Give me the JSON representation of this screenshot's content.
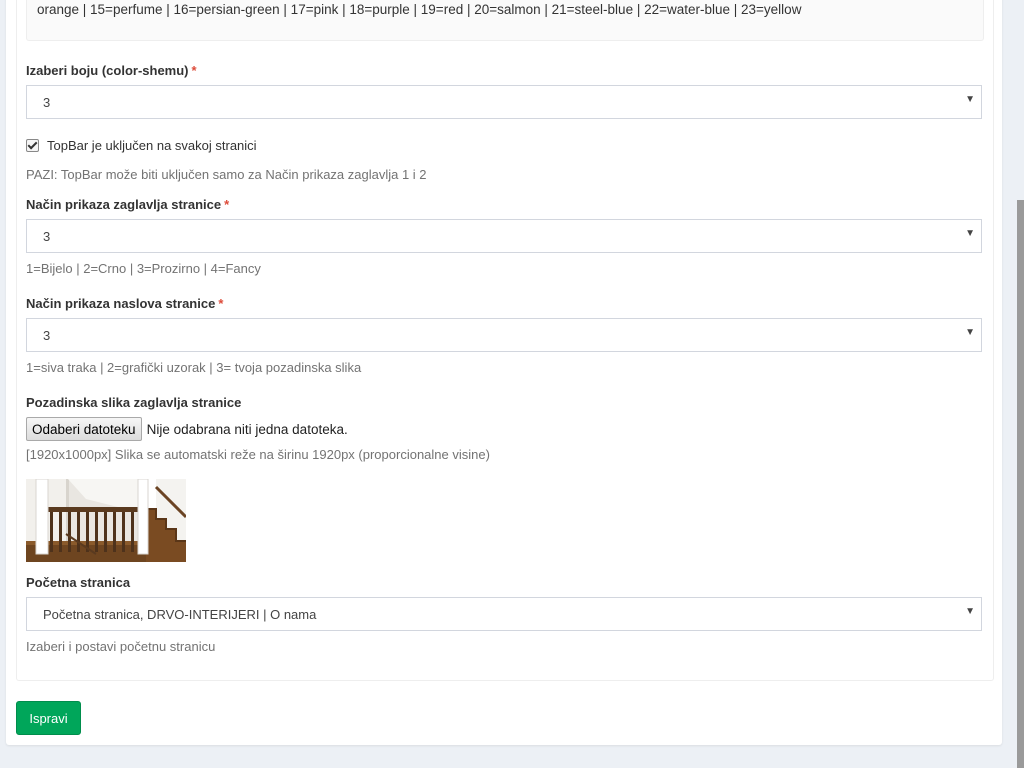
{
  "info": {
    "text": "orange | 15=perfume | 16=persian-green | 17=pink | 18=purple | 19=red | 20=salmon | 21=steel-blue | 22=water-blue | 23=yellow"
  },
  "color_scheme": {
    "label": "Izaberi boju (color-shemu)",
    "required_mark": "*",
    "value": "3"
  },
  "topbar": {
    "label": "TopBar je uključen na svakoj stranici",
    "checked": true,
    "help": "PAZI: TopBar može biti uključen samo za Način prikaza zaglavlja 1 i 2"
  },
  "header_mode": {
    "label": "Način prikaza zaglavlja stranice",
    "required_mark": "*",
    "value": "3",
    "help": "1=Bijelo | 2=Crno | 3=Prozirno | 4=Fancy"
  },
  "title_mode": {
    "label": "Način prikaza naslova stranice",
    "required_mark": "*",
    "value": "3",
    "help": "1=siva traka | 2=grafički uzorak | 3= tvoja pozadinska slika"
  },
  "header_image": {
    "label": "Pozadinska slika zaglavlja stranice",
    "button_label": "Odaberi datoteku",
    "status": "Nije odabrana niti jedna datoteka.",
    "help": "[1920x1000px] Slika se automatski reže na širinu 1920px (proporcionalne visine)"
  },
  "home_page": {
    "label": "Početna stranica",
    "value": "Početna stranica, DRVO-INTERIJERI | O nama",
    "help": "Izaberi i postavi početnu stranicu"
  },
  "submit": {
    "label": "Ispravi"
  },
  "colors": {
    "accent_green": "#00a65a",
    "required_red": "#dd4b39",
    "page_bg": "#ecf0f5"
  },
  "icons": {
    "select_caret": "caret-down-icon"
  }
}
